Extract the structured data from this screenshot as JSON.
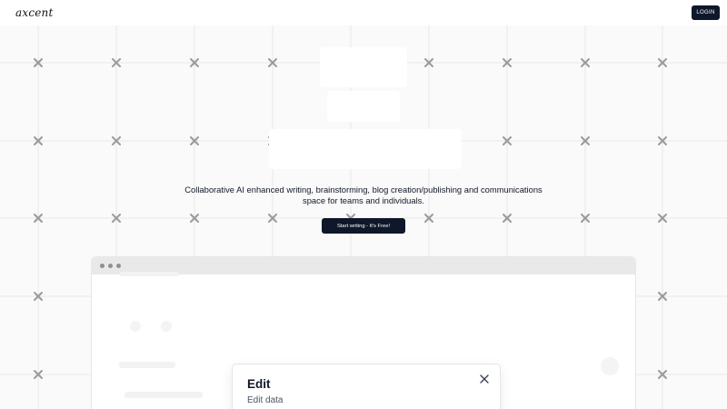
{
  "nav": {
    "logo": "axcent",
    "login_label": "LOGIN"
  },
  "hero": {
    "tagline_line1": "Collaborative AI enhanced writing, brainstorming, blog creation/publishing and communications",
    "tagline_line2": "space for teams and individuals.",
    "cta_label": "Start writing - It's Free!"
  },
  "modal": {
    "title": "Edit",
    "subtitle": "Edit data",
    "close_icon": "close-icon"
  },
  "icons": {
    "grid_marker": "cross-marker-icon"
  },
  "colors": {
    "primary": "#0f172a",
    "background": "#fafafa",
    "grid_line": "#e8e8ea",
    "marker": "#9a9aa0"
  }
}
